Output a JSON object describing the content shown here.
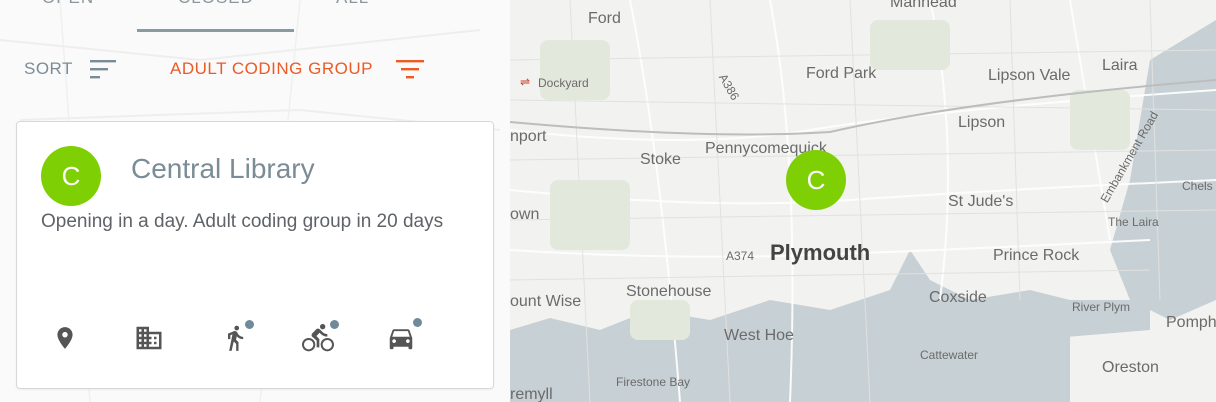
{
  "tabs": {
    "open": "Open",
    "closed": "Closed",
    "all": "All"
  },
  "toolbar": {
    "sort_label": "SORT",
    "filter_label": "ADULT CODING GROUP"
  },
  "card": {
    "avatar_letter": "C",
    "title": "Central Library",
    "description": "Opening in a day. Adult coding group in 20 days"
  },
  "map": {
    "marker_letter": "C",
    "labels": {
      "ford": "Ford",
      "manhead": "Manhead",
      "dockyard": "Dockyard",
      "a386": "A386",
      "ford_park": "Ford Park",
      "lipson_vale": "Lipson Vale",
      "laira": "Laira",
      "lipson": "Lipson",
      "embankment_road": "Embankment Road",
      "nport": "nport",
      "stoke": "Stoke",
      "pennycomequick": "Pennycomequick",
      "chels": "Chels",
      "st_judes": "St Jude's",
      "the_laira": "The Laira",
      "own": "own",
      "a374": "A374",
      "plymouth": "Plymouth",
      "prince_rock": "Prince Rock",
      "mount_wise": "ount Wise",
      "stonehouse": "Stonehouse",
      "coxside": "Coxside",
      "river_plym": "River Plym",
      "pomphle": "Pomphle",
      "west_hoe": "West Hoe",
      "cattewater": "Cattewater",
      "oreston": "Oreston",
      "firestone_bay": "Firestone Bay",
      "cremyll": "remyll"
    }
  },
  "colors": {
    "accent": "#ec5a26",
    "marker": "#7fcf05",
    "muted_text": "#7a8c96"
  }
}
